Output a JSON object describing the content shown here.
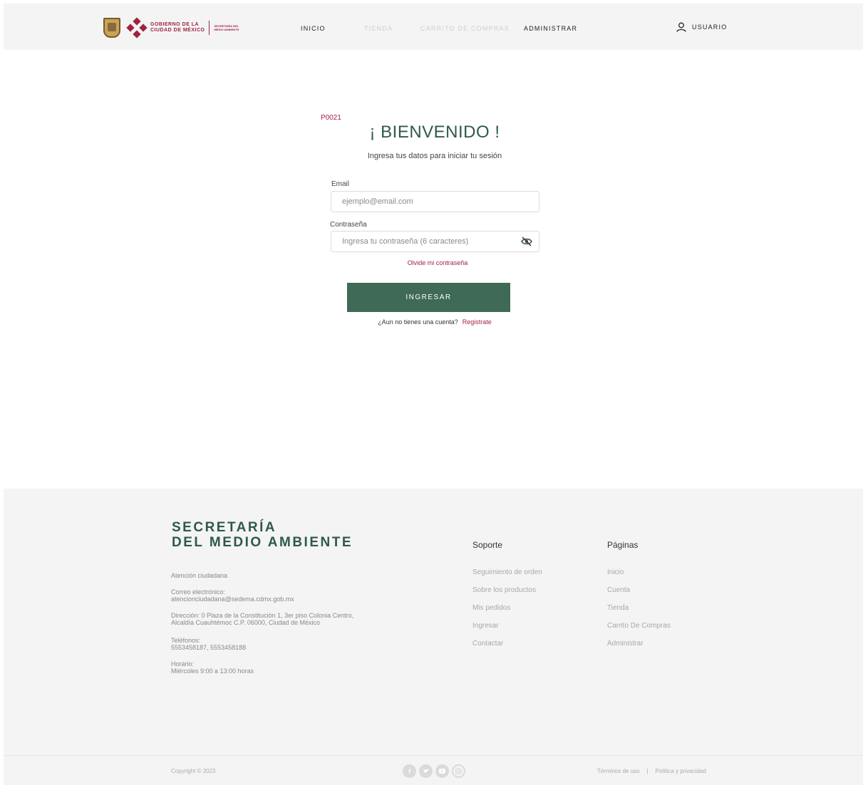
{
  "header": {
    "gov_line1": "GOBIERNO DE LA",
    "gov_line2": "CIUDAD DE MÉXICO",
    "sec_line1": "SECRETARÍA DEL",
    "sec_line2": "MEDIO AMBIENTE",
    "nav": {
      "inicio": "INICIO",
      "tienda": "TIENDA",
      "carrito": "CARRITO DE COMPRAS",
      "administrar": "ADMINISTRAR",
      "usuario": "USUARIO"
    }
  },
  "login": {
    "code": "P0021",
    "title": "¡ BIENVENIDO !",
    "subtitle": "Ingresa tus datos para iniciar tu sesión",
    "email_label": "Email",
    "email_placeholder": "ejemplo@email.com",
    "password_label": "Contraseña",
    "password_placeholder": "Ingresa tu contraseña (6 caracteres)",
    "forgot": "Olvide mi contraseña",
    "submit": "INGRESAR",
    "no_account": "¿Aun no tienes una cuenta?",
    "register": "Registrate"
  },
  "footer": {
    "brand_line1": "SECRETARÍA",
    "brand_line2": "DEL MEDIO AMBIENTE",
    "contact": {
      "attention": "Atención ciudadana",
      "email_label": "Correo electrónico:",
      "email": "atencionciudadana@sedema.cdmx.gob.mx",
      "address_line1": "Dirección: 0 Plaza de la Constitución 1, 3er piso Colonia Centro,",
      "address_line2": "Alcaldía Cuauhtémoc C.P. 06000, Ciudad de México",
      "phones_label": "Teléfonos:",
      "phones": "5553458187, 5553458188",
      "schedule_label": "Horario:",
      "schedule": "Miércoles 9:00 a 13:00 horas"
    },
    "soporte_title": "Soporte",
    "soporte_items": [
      "Seguimiento de orden",
      "Sobre los productos",
      "Mis pedidos",
      "Ingresar",
      "Contactar"
    ],
    "paginas_title": "Páginas",
    "paginas_items": [
      "Inicio",
      "Cuenta",
      "Tienda",
      "Carrito De Compras",
      "Administrar"
    ],
    "copyright": "Copyright © 2023",
    "socials": [
      "facebook-icon",
      "twitter-icon",
      "youtube-icon",
      "instagram-icon"
    ],
    "terms": "Términos de uso",
    "separator": "|",
    "privacy": "Política y privacidad"
  },
  "colors": {
    "primary_green": "#3f6a56",
    "accent_maroon": "#9f2241",
    "header_bg": "#f4f4f4"
  }
}
